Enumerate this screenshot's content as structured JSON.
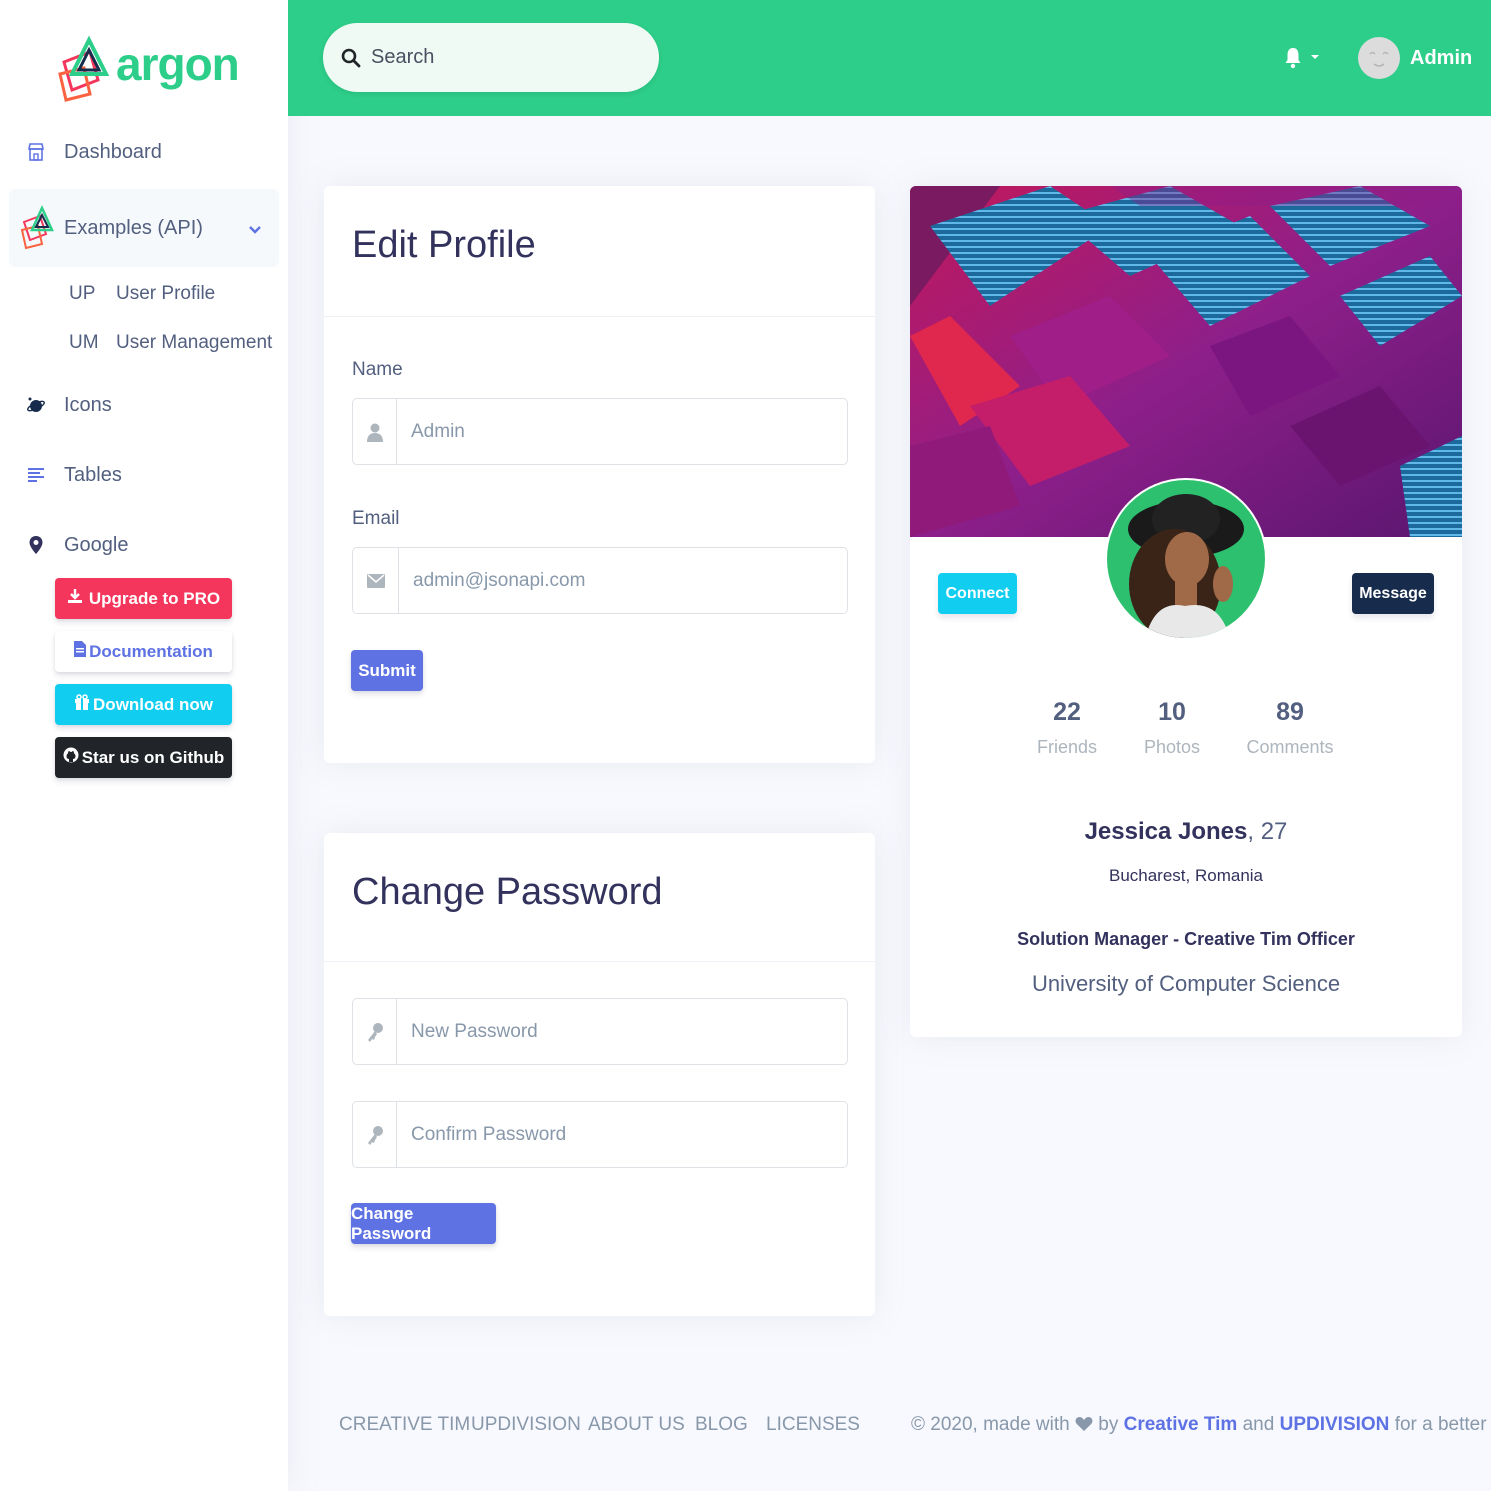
{
  "brand": {
    "name": "argon"
  },
  "sidebar": {
    "items": [
      {
        "label": "Dashboard",
        "icon": "shop-icon"
      },
      {
        "label": "Examples (API)",
        "icon": "laravel-icon"
      },
      {
        "label": "Icons",
        "icon": "planet-icon"
      },
      {
        "label": "Tables",
        "icon": "bullet-list-icon"
      },
      {
        "label": "Google",
        "icon": "pin-icon"
      }
    ],
    "subitems": [
      {
        "abbr": "UP",
        "label": "User Profile"
      },
      {
        "abbr": "UM",
        "label": "User Management"
      }
    ],
    "buttons": {
      "upgrade": "Upgrade to PRO",
      "docs": "Documentation",
      "download": "Download now",
      "github": "Star us on Github"
    }
  },
  "header": {
    "search_placeholder": "Search",
    "user_name": "Admin"
  },
  "edit_profile": {
    "title": "Edit Profile",
    "name_label": "Name",
    "name_value": "Admin",
    "email_label": "Email",
    "email_value": "admin@jsonapi.com",
    "submit": "Submit"
  },
  "change_password": {
    "title": "Change Password",
    "new_placeholder": "New Password",
    "confirm_placeholder": "Confirm Password",
    "button": "Change Password"
  },
  "profile_card": {
    "connect": "Connect",
    "message": "Message",
    "stats": [
      {
        "value": "22",
        "label": "Friends"
      },
      {
        "value": "10",
        "label": "Photos"
      },
      {
        "value": "89",
        "label": "Comments"
      }
    ],
    "name": "Jessica Jones",
    "age": ", 27",
    "location": "Bucharest, Romania",
    "job": "Solution Manager - Creative Tim Officer",
    "education": "University of Computer Science"
  },
  "footer": {
    "links": [
      "CREATIVE TIM",
      "UPDIVISION",
      "ABOUT US",
      "BLOG",
      "LICENSES"
    ],
    "copy_prefix": "© 2020, made with",
    "copy_by": "by",
    "creative_tim": "Creative Tim",
    "and": "and",
    "updivision": "UPDIVISION",
    "copy_suffix": "for a better web."
  },
  "colors": {
    "primary": "#5e72e4",
    "success": "#2dce89",
    "info": "#11cdef",
    "danger": "#f5365c",
    "dark": "#172b4d"
  }
}
